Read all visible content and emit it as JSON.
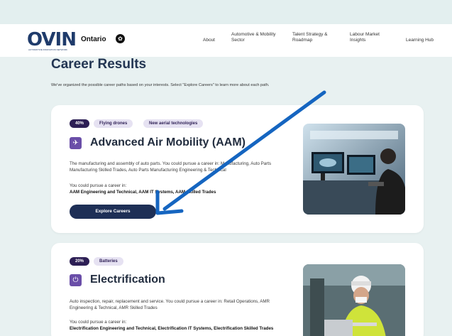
{
  "header": {
    "logo": "OVIN",
    "logo_sub": "AUTOMOTIVE INNOVATION NETWORK",
    "partner": "Ontario",
    "nav": [
      {
        "label": "About"
      },
      {
        "label": "Automotive & Mobility Sector"
      },
      {
        "label": "Talent Strategy & Roadmap"
      },
      {
        "label": "Labour Market Insights"
      },
      {
        "label": "Learning Hub"
      }
    ]
  },
  "main": {
    "title": "Career Results",
    "intro": "We've organized the possible career paths based on your interests. Select \"Explore Careers\" to learn more about each path.",
    "cards": [
      {
        "percent": "40%",
        "tags": [
          "Flying drones",
          "New aerial technologies"
        ],
        "title": "Advanced Air Mobility (AAM)",
        "icon": "drone-icon",
        "description": "The manufacturing and assembly of auto parts. You could pursue a career in: Manufacturing, Auto Parts Manufacturing Skilled Trades, Auto Parts Manufacturing Engineering & Technical",
        "pursue_label": "You could pursue a career in:",
        "pursue": "AAM Engineering and Technical, AAM IT Systems, AAM Skilled Trades",
        "button": "Explore Careers"
      },
      {
        "percent": "20%",
        "tags": [
          "Batteries"
        ],
        "title": "Electrification",
        "icon": "plug-icon",
        "description": "Auto inspection, repair, replacement and service. You could pursue a career in: Retail Operations, AMR Engineering & Technical, AMR Skilled Trades",
        "pursue_label": "You could pursue a career in:",
        "pursue": "Electrification Engineering and Technical, Electrification IT Systems, Electrification Skilled Trades"
      }
    ]
  },
  "colors": {
    "background": "#e8f1f1",
    "navy": "#1e2f56",
    "purple_badge": "#2d1f55",
    "tag_bg": "#e6e2f2",
    "arrow": "#1565c0"
  }
}
